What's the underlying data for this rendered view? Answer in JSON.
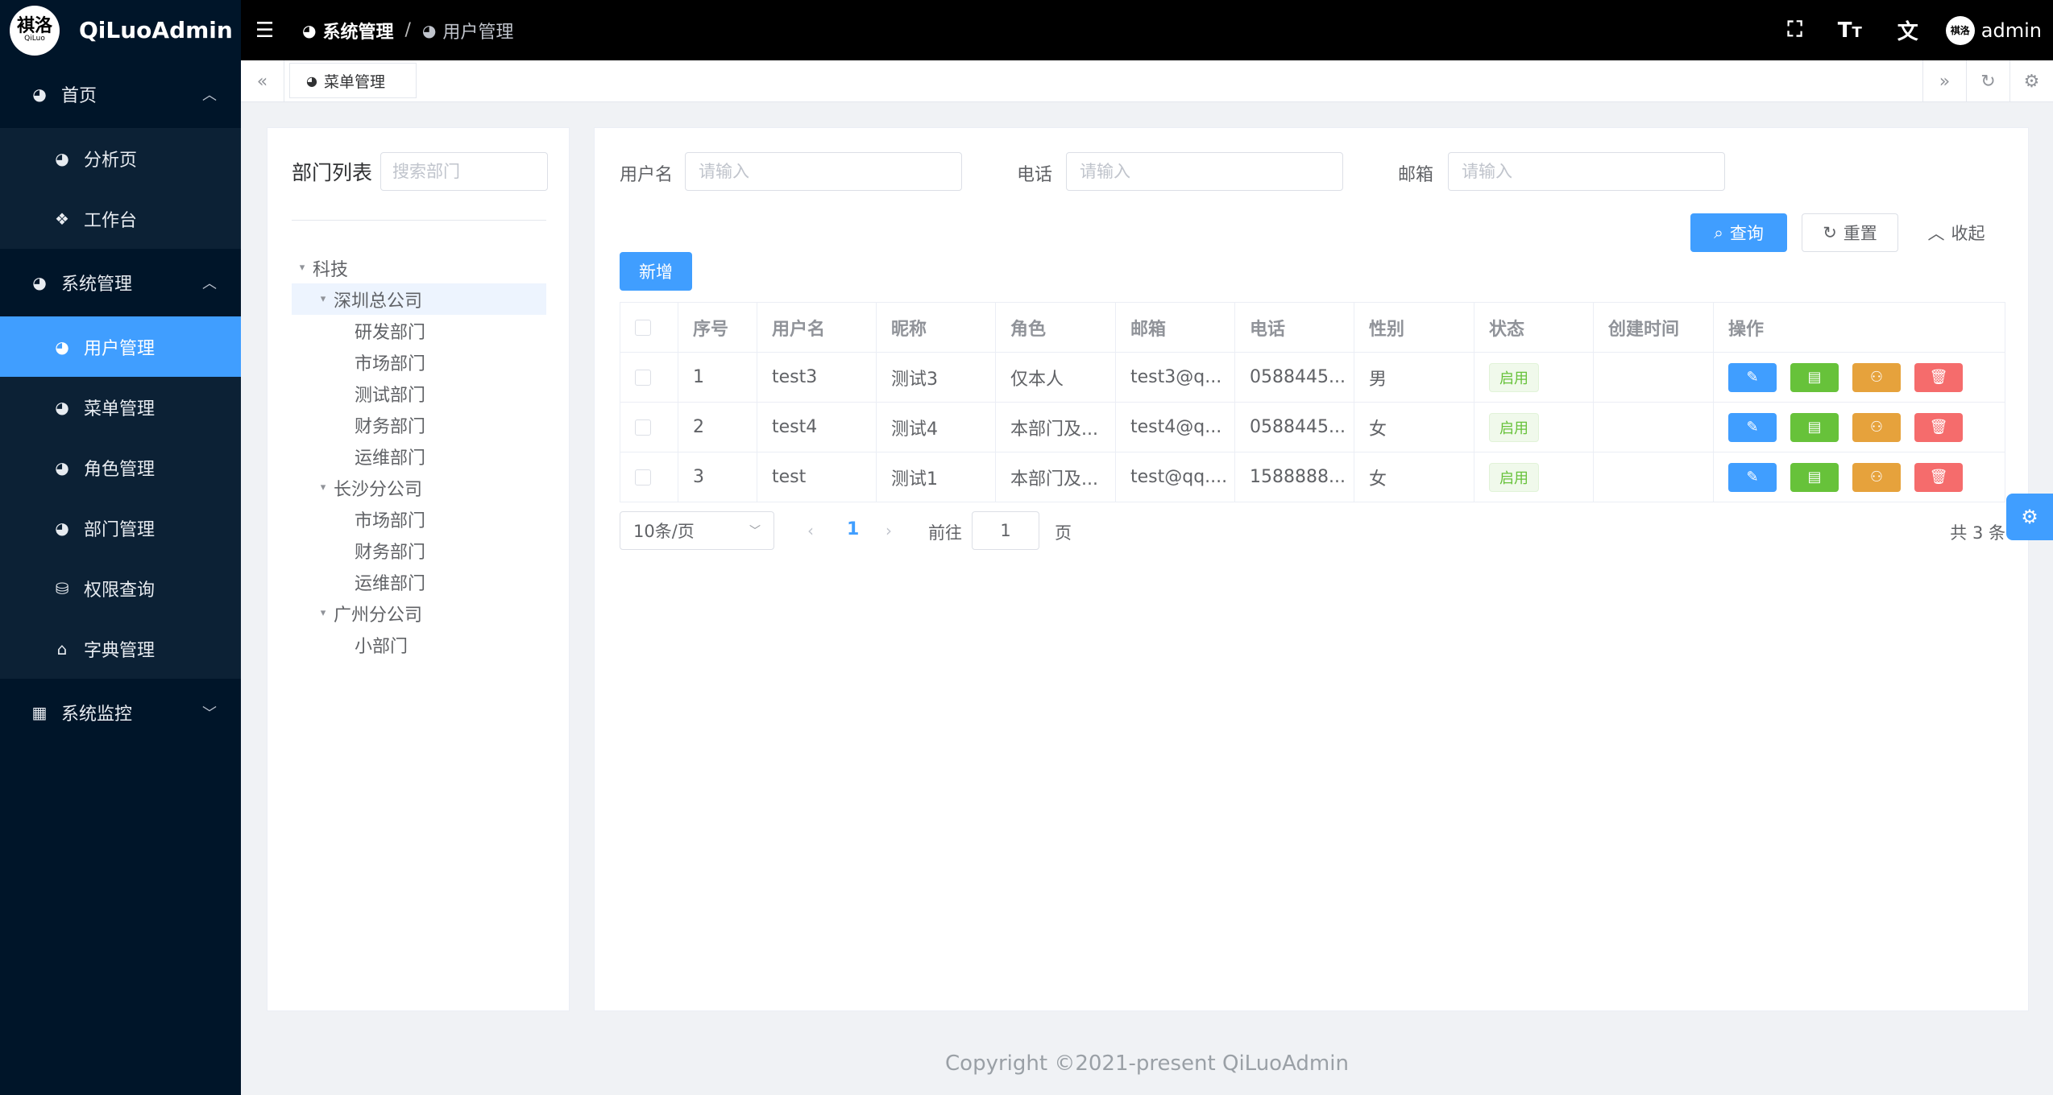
{
  "app": {
    "logo_text": "褀洛",
    "logo_sub": "QiLuo",
    "title": "QiLuoAdmin"
  },
  "sidebar": {
    "groups": [
      {
        "label": "首页",
        "icon": "dashboard-icon",
        "expanded": true,
        "items": [
          {
            "label": "分析页",
            "icon": "dashboard-icon"
          },
          {
            "label": "工作台",
            "icon": "codepen-icon"
          }
        ]
      },
      {
        "label": "系统管理",
        "icon": "dashboard-icon",
        "expanded": true,
        "items": [
          {
            "label": "用户管理",
            "icon": "dashboard-icon",
            "active": true
          },
          {
            "label": "菜单管理",
            "icon": "dashboard-icon"
          },
          {
            "label": "角色管理",
            "icon": "dashboard-icon"
          },
          {
            "label": "部门管理",
            "icon": "dashboard-icon"
          },
          {
            "label": "权限查询",
            "icon": "database-icon"
          },
          {
            "label": "字典管理",
            "icon": "bank-icon"
          }
        ]
      },
      {
        "label": "系统监控",
        "icon": "calendar-icon",
        "expanded": false,
        "items": []
      }
    ]
  },
  "header": {
    "breadcrumb": [
      "系统管理",
      "用户管理"
    ],
    "username": "admin",
    "avatar_text": "褀洛"
  },
  "tags": {
    "items": [
      "菜单管理"
    ]
  },
  "dept": {
    "title": "部门列表",
    "search_placeholder": "搜索部门",
    "tree": [
      {
        "label": "科技",
        "level": 0,
        "arrow": "▾"
      },
      {
        "label": "深圳总公司",
        "level": 1,
        "arrow": "▾",
        "selected": true
      },
      {
        "label": "研发部门",
        "level": 2
      },
      {
        "label": "市场部门",
        "level": 2
      },
      {
        "label": "测试部门",
        "level": 2
      },
      {
        "label": "财务部门",
        "level": 2
      },
      {
        "label": "运维部门",
        "level": 2
      },
      {
        "label": "长沙分公司",
        "level": 1,
        "arrow": "▾"
      },
      {
        "label": "市场部门",
        "level": 2
      },
      {
        "label": "财务部门",
        "level": 2
      },
      {
        "label": "运维部门",
        "level": 2
      },
      {
        "label": "广州分公司",
        "level": 1,
        "arrow": "▾"
      },
      {
        "label": "小部门",
        "level": 2
      }
    ]
  },
  "search": {
    "username_label": "用户名",
    "username_placeholder": "请输入",
    "phone_label": "电话",
    "phone_placeholder": "请输入",
    "email_label": "邮箱",
    "email_placeholder": "请输入",
    "query_label": "查询",
    "reset_label": "重置",
    "collapse_label": "收起"
  },
  "toolbar": {
    "add_label": "新增"
  },
  "table": {
    "columns": [
      "序号",
      "用户名",
      "昵称",
      "角色",
      "邮箱",
      "电话",
      "性别",
      "状态",
      "创建时间",
      "操作"
    ],
    "rows": [
      {
        "index": "1",
        "username": "test3",
        "nickname": "测试3",
        "role": "仅本人",
        "email": "test3@q...",
        "phone": "0588445...",
        "gender": "男",
        "status": "启用",
        "created": ""
      },
      {
        "index": "2",
        "username": "test4",
        "nickname": "测试4",
        "role": "本部门及...",
        "email": "test4@q...",
        "phone": "0588445...",
        "gender": "女",
        "status": "启用",
        "created": ""
      },
      {
        "index": "3",
        "username": "test",
        "nickname": "测试1",
        "role": "本部门及...",
        "email": "test@qq....",
        "phone": "1588888...",
        "gender": "女",
        "status": "启用",
        "created": ""
      }
    ]
  },
  "pagination": {
    "page_size": "10条/页",
    "current_page": "1",
    "goto_label": "前往",
    "goto_value": "1",
    "page_unit": "页",
    "total": "共 3 条"
  },
  "footer": {
    "text": "Copyright ©2021-present QiLuoAdmin"
  },
  "colors": {
    "primary": "#409eff",
    "success": "#67c23a",
    "warning": "#e6a23c",
    "danger": "#f56c6c",
    "sidebar_bg": "#001529"
  }
}
